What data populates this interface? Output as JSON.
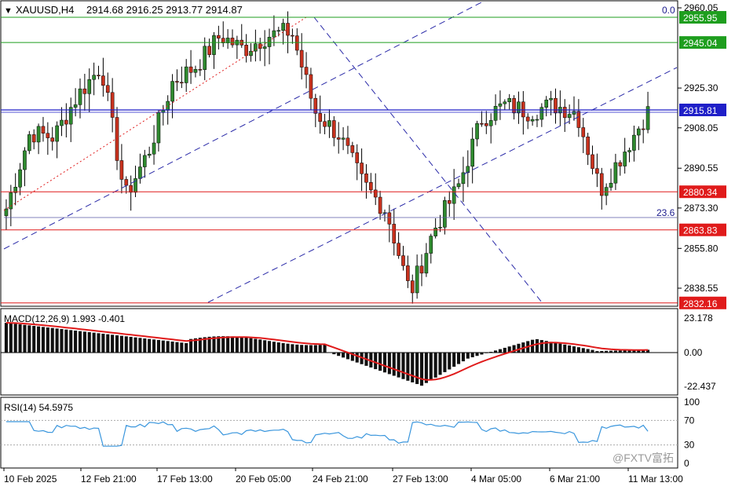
{
  "header": {
    "symbol": "XAUUSD,H4",
    "ohlc": "2914.68 2916.25 2913.77 2914.87"
  },
  "price_axis": {
    "ticks": [
      "2960.05",
      "2925.30",
      "2908.05",
      "2890.55",
      "2873.30",
      "2855.80",
      "2838.55"
    ]
  },
  "levels": [
    {
      "label": "2955.95",
      "value": 2955.95,
      "kind": "resistance",
      "color": "#1e9e1e"
    },
    {
      "label": "2945.04",
      "value": 2945.04,
      "kind": "resistance",
      "color": "#1e9e1e"
    },
    {
      "label": "2915.81",
      "value": 2915.81,
      "kind": "current",
      "color": "#1f1fc8"
    },
    {
      "label": "2880.34",
      "value": 2880.34,
      "kind": "support",
      "color": "#e01b1b"
    },
    {
      "label": "2863.83",
      "value": 2863.83,
      "kind": "support",
      "color": "#e01b1b"
    },
    {
      "label": "2832.16",
      "value": 2832.16,
      "kind": "support",
      "color": "#e01b1b"
    }
  ],
  "fib_labels": {
    "top": "0.0",
    "mid": "23.6"
  },
  "macd": {
    "label": "MACD(12,26,9) 1.993 -0.401",
    "ticks": [
      "23.178",
      "0.00",
      "-22.437"
    ]
  },
  "rsi": {
    "label": "RSI(14) 54.5975",
    "ticks": [
      "100",
      "70",
      "30",
      "0"
    ]
  },
  "time_axis": [
    "10 Feb 2025",
    "12 Feb 21:00",
    "17 Feb 13:00",
    "20 Feb 05:00",
    "24 Feb 21:00",
    "27 Feb 13:00",
    "4 Mar 05:00",
    "6 Mar 21:00",
    "11 Mar 13:00"
  ],
  "watermark": "@FXTV富拓",
  "colors": {
    "bull": "#2f8a2f",
    "bear": "#c8321e",
    "macd_signal": "#e01b1b",
    "rsi_line": "#3a96dd"
  },
  "chart_data": {
    "type": "candlestick",
    "symbol": "XAUUSD",
    "timeframe": "H4",
    "title": "XAUUSD,H4",
    "x": [
      "10 Feb 2025",
      "12 Feb 21:00",
      "17 Feb 13:00",
      "20 Feb 05:00",
      "24 Feb 21:00",
      "27 Feb 13:00",
      "4 Mar 05:00",
      "6 Mar 21:00",
      "11 Mar 13:00"
    ],
    "close_path": [
      [
        "10 Feb 2025",
        2873
      ],
      [
        "11 Feb",
        2906
      ],
      [
        "12 Feb 21:00",
        2904
      ],
      [
        "13 Feb",
        2922
      ],
      [
        "14 Feb",
        2935
      ],
      [
        "17 Feb",
        2878
      ],
      [
        "17 Feb 13:00",
        2898
      ],
      [
        "18 Feb",
        2928
      ],
      [
        "19 Feb",
        2935
      ],
      [
        "20 Feb 05:00",
        2948
      ],
      [
        "21 Feb",
        2942
      ],
      [
        "21 Feb 2",
        2948
      ],
      [
        "24 Feb",
        2950
      ],
      [
        "24 Feb 21:00",
        2915
      ],
      [
        "25 Feb",
        2905
      ],
      [
        "26 Feb",
        2884
      ],
      [
        "27 Feb",
        2872
      ],
      [
        "27 Feb 13:00",
        2836
      ],
      [
        "28 Feb",
        2864
      ],
      [
        "3 Mar",
        2882
      ],
      [
        "4 Mar 05:00",
        2912
      ],
      [
        "5 Mar",
        2918
      ],
      [
        "6 Mar",
        2915
      ],
      [
        "6 Mar 21:00",
        2918
      ],
      [
        "7 Mar",
        2915
      ],
      [
        "10 Mar",
        2881
      ],
      [
        "11 Mar",
        2898
      ],
      [
        "11 Mar 13:00",
        2915
      ]
    ],
    "ylim": [
      2830,
      2962
    ],
    "macd": {
      "params": "12,26,9",
      "main": 1.993,
      "signal": -0.401,
      "ylim": [
        -22.437,
        23.178
      ]
    },
    "rsi": {
      "period": 14,
      "value": 54.5975,
      "ylim": [
        0,
        100
      ],
      "levels": [
        70,
        30
      ]
    }
  }
}
